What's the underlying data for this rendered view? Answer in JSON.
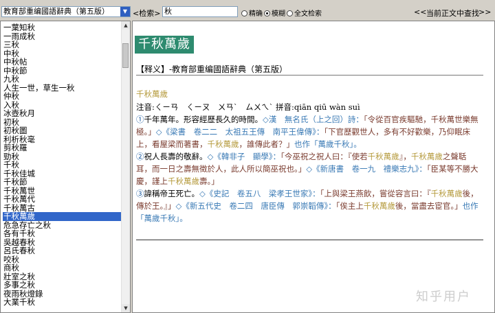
{
  "toolbar": {
    "dictionary_selected": "教育部重编國語辭典（第五版）",
    "search_label": "<检索>",
    "search_value": "秋",
    "modes": [
      {
        "label": "精确",
        "selected": false
      },
      {
        "label": "模糊",
        "selected": true
      },
      {
        "label": "全文检索",
        "selected": false
      }
    ],
    "nav_prev": "<<",
    "nav_label": "当前正文中查找",
    "nav_next": ">>"
  },
  "word_list": [
    "一葉知秋",
    "一雨成秋",
    "三秋",
    "中秋",
    "中秋帖",
    "中秋節",
    "九秋",
    "人生一世，草生一秋",
    "仲秋",
    "入秋",
    "冰壺秋月",
    "初秋",
    "初秋圖",
    "利析秋毫",
    "剪秋羅",
    "勁秋",
    "千秋",
    "千秋佳城",
    "千秋節",
    "千秋萬世",
    "千秋萬代",
    "千秋萬古",
    "千秋萬歲",
    "危急存亡之秋",
    "各有千秋",
    "吳越春秋",
    "呂氏春秋",
    "咬秋",
    "商秋",
    "壯室之秋",
    "多事之秋",
    "夜雨秋燈錄",
    "大業千秋"
  ],
  "selected_word": "千秋萬歲",
  "entry": {
    "headword": "千秋萬歲",
    "source_line": "【释义】-教育部重编國語辭典（第五版）",
    "sub_headword": "千秋萬歲",
    "pronunciation": "注音:ㄑㄧㄢ　ㄑㄧㄡ　ㄨㄢˋ　ㄙㄨㄟˋ 拼音:qiān qiū wàn suì",
    "sense1_num": "①",
    "sense1_def": "千年萬年。形容經歷長久的時間。",
    "sense1_c1": "◇漢　無名氏（上之回）詩：",
    "sense1_q1": "「令從百官疾驅馳，千秋萬世樂無極。」",
    "sense1_c2": "◇《梁書　卷二二　太祖五王傳　南平王偉傳》：",
    "sense1_q2": "「下官歷觀世人，多有不好歡樂，乃仰眠床上，看屋梁而著書，",
    "sense1_h1": "千秋萬歲",
    "sense1_q3": "，誰傳此者？」",
    "sense1_also": "也作「萬歲千秋」。",
    "sense2_num": "②",
    "sense2_def": "祝人長壽的敬辭。",
    "sense2_c1": "◇《韓非子　顯學》：",
    "sense2_q1": "「今巫祝之祝人曰：『使若",
    "sense2_h1": "千秋萬歲",
    "sense2_q2": "』，",
    "sense2_h2": "千秋萬歲",
    "sense2_q3": "之聲聒耳，而一日之壽無徵於人，此人所以簡巫祝也。」",
    "sense2_c2": "◇《新唐書　卷一九　禮樂志九》：",
    "sense2_q4": "「臣某等不勝大慶，謹上",
    "sense2_h3": "千秋萬歲",
    "sense2_q5": "壽。」",
    "sense3_num": "③",
    "sense3_def": "諱稱帝王死亡。",
    "sense3_c1": "◇《史記　卷五八　梁孝王世家》：",
    "sense3_q1": "「上與梁王燕飲，嘗從容言曰：『",
    "sense3_h1": "千秋萬歲",
    "sense3_q2": "後，傳於王。』」",
    "sense3_c2": "◇《新五代史　卷二四　唐臣傳　郭崇韜傳》：",
    "sense3_q3": "「俟主上",
    "sense3_h2": "千秋萬歲",
    "sense3_q4": "後，當盡去宦官。」",
    "sense3_also": "也作「萬歲千秋」。"
  },
  "watermark": "知乎用户",
  "colors": {
    "headword_bg": "#2e8b6f",
    "selection": "#3166c9",
    "citation": "#3a7ab5",
    "highlight": "#b59a3c",
    "quote": "#7a3b2e"
  }
}
